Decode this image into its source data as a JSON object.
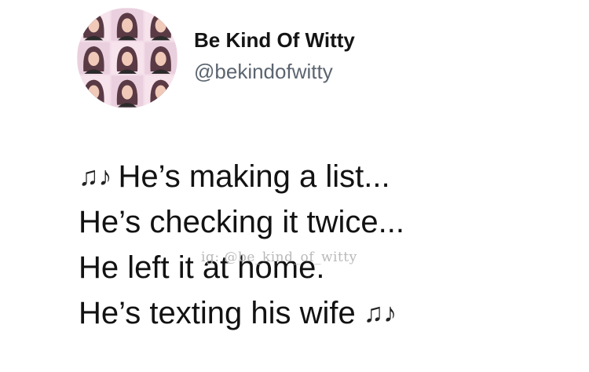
{
  "author": {
    "display_name": "Be Kind Of Witty",
    "handle": "@bekindofwitty",
    "avatar_icon": "avatar-collage-icon"
  },
  "tweet": {
    "lines": [
      "He’s making a list...",
      "He’s checking it twice...",
      "He left it at home.",
      "He’s texting his wife"
    ],
    "music_icon": "♫♪"
  },
  "watermark": "ig: @be_kind_of_witty",
  "colors": {
    "background": "#ffffff",
    "text": "#121212",
    "handle": "#5b6570",
    "avatar_tint": "#f2d9e6"
  }
}
